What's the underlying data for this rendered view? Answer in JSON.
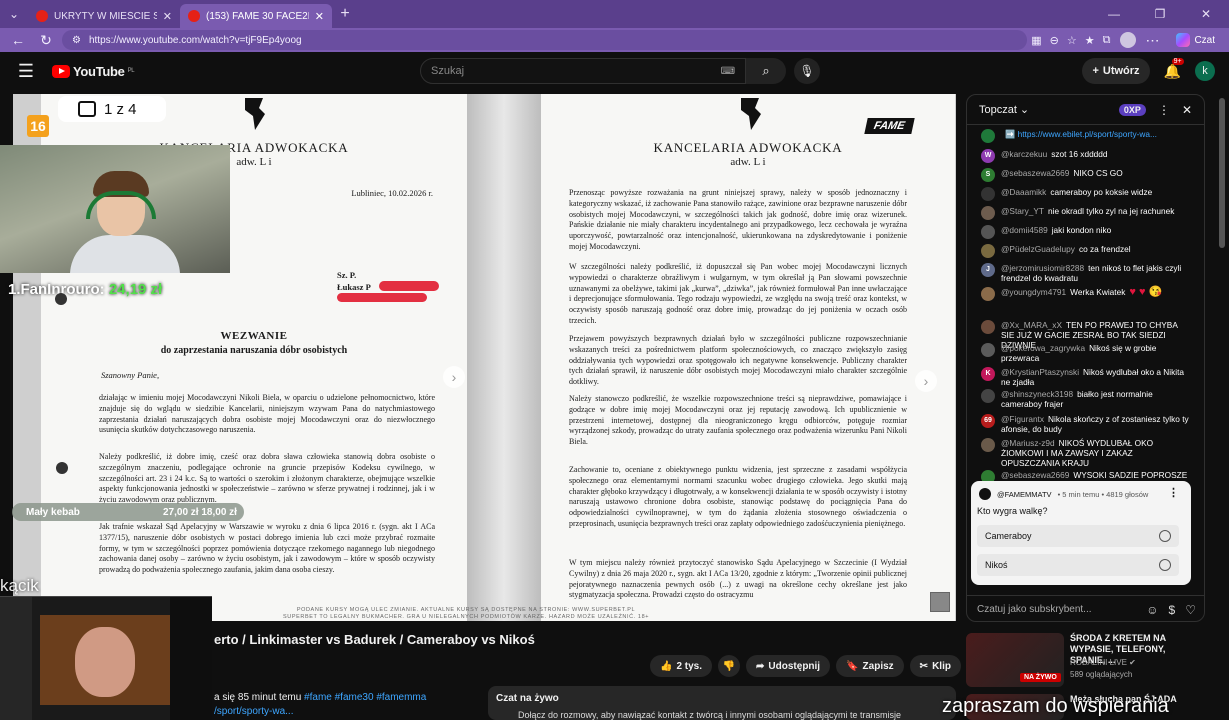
{
  "browser": {
    "tabs": [
      {
        "label": "UKRYTY W MIEŚCIE SZYB - YouTu"
      },
      {
        "label": "(153) FAME 30 FACE2FACE: Wiewió"
      }
    ],
    "url": "https://www.youtube.com/watch?v=tjF9Ep4yoog",
    "copilot_label": "Czat"
  },
  "youtube": {
    "logo": "YouTube",
    "logo_country": "PL",
    "search_placeholder": "Szukaj",
    "create_label": "Utwórz",
    "notif_count": "9+",
    "avatar_letter": "k"
  },
  "player": {
    "page_indicator": "1 z 4",
    "age_rating": "16",
    "fame_logo": "FAME",
    "left_doc": {
      "firm": "KANCELARIA ADWOKACKA",
      "firm_sub": "adw. L          i",
      "date": "Lubliniec, 10.02.2026 r.",
      "addr1": "Sz. P.",
      "addr2": "Łukasz P",
      "title": "WEZWANIE",
      "subtitle": "do zaprzestania naruszania dóbr osobistych",
      "salutation": "Szanowny Panie,",
      "p1": "działając w imieniu mojej Mocodawczyni Nikoli Biela, w oparciu o udzielone pełnomocnictwo, które znajduje się do wglądu w siedzibie Kancelarii, niniejszym wzywam Pana do natychmiastowego zaprzestania działań naruszających dobra osobiste mojej Mocodawczyni oraz do niezwłocznego usunięcia skutków dotychczasowego naruszenia.",
      "p2": "Należy podkreślić, iż dobre imię, cześć oraz dobra sława człowieka stanowią dobra osobiste o szczególnym znaczeniu, podlegające ochronie na gruncie przepisów Kodeksu cywilnego, w szczególności art. 23 i 24 k.c. Są to wartości o szerokim i złożonym charakterze, obejmujące wszelkie aspekty funkcjonowania jednostki w społeczeństwie – zarówno w sferze prywatnej i rodzinnej, jak i w życiu zawodowym oraz publicznym.",
      "p3": "Jak trafnie wskazał Sąd Apelacyjny w Warszawie w wyroku z dnia 6 lipca 2016 r. (sygn. akt I ACa 1377/15), naruszenie dóbr osobistych w postaci dobrego imienia lub czci może przybrać rozmaite formy, w tym w szczególności poprzez pomówienia dotyczące rzekomego nagannego lub niegodnego zachowania danej osoby – zarówno w życiu osobistym, jak i zawodowym – które w sposób oczywisty prowadzą do podważenia społecznego zaufania, jakim dana osoba cieszy."
    },
    "right_doc": {
      "firm": "KANCELARIA ADWOKACKA",
      "firm_sub": "adw. L          i",
      "p1": "Przenosząc powyższe rozważania na grunt niniejszej sprawy, należy w sposób jednoznaczny i kategoryczny wskazać, iż zachowanie Pana stanowiło rażące, zawinione oraz bezprawne naruszenie dóbr osobistych mojej Mocodawczyni, w szczególności takich jak godność, dobre imię oraz wizerunek. Pańskie działanie nie miały charakteru incydentalnego ani przypadkowego, lecz cechowała je wyraźna uporczywość, powtarzalność oraz intencjonalność, ukierunkowana na zdyskredytowanie i poniżenie mojej Mocodawczyni.",
      "p2": "W szczególności należy podkreślić, iż dopuszczał się Pan wobec mojej Mocodawczyni licznych wypowiedzi o charakterze obraźliwym i wulgarnym, w tym określał ją Pan słowami powszechnie uznawanymi za obelżywe, takimi jak „kurwa”, „dziwka”, jak również formułował Pan inne uwłaczające i deprecjonujące sformułowania. Tego rodzaju wypowiedzi, ze względu na swoją treść oraz kontekst, w oczywisty sposób naruszają godność oraz dobre imię, prowadząc do jej poniżenia w oczach osób trzecich.",
      "p3": "Przejawem powyższych bezprawnych działań było w szczególności publiczne rozpowszechnianie wskazanych treści za pośrednictwem platform społecznościowych, co znacząco zwiększyło zasięg oddziaływania tych wypowiedzi oraz spotęgowało ich negatywne konsekwencje. Publiczny charakter tych działań sprawił, iż naruszenie dóbr osobistych mojej Mocodawczyni miało charakter szczególnie dotkliwy.",
      "p4": "Należy stanowczo podkreślić, że wszelkie rozpowszechnione treści są nieprawdziwe, pomawiające i godzące w dobre imię mojej Mocodawczyni oraz jej reputację zawodową. Ich upublicznienie w przestrzeni internetowej, dostępnej dla nieograniczonego kręgu odbiorców, potęguje rozmiar wyrządzonej szkody, prowadząc do utraty zaufania społecznego oraz podważenia wizerunku Pani Nikoli Biela.",
      "p5": "Zachowanie to, oceniane z obiektywnego punktu widzenia, jest sprzeczne z zasadami współżycia społecznego oraz elementarnymi normami szacunku wobec drugiego człowieka. Jego skutki mają charakter głęboko krzywdzący i długotrwały, a w konsekwencji działania te w sposób oczywisty i istotny naruszają ustawowo chronione dobra osobiste, stanowiąc podstawę do pociągnięcia Pana do odpowiedzialności cywilnoprawnej, w tym do żądania złożenia stosownego oświadczenia o przeprosinach, usunięcia bezprawnych treści oraz zapłaty odpowiedniego zadośćuczynienia pieniężnego.",
      "p6": "W tym miejscu należy również przytoczyć stanowisko Sądu Apelacyjnego w Szczecinie (I Wydział Cywilny) z dnia 26 maja 2020 r., sygn. akt I ACa 13/20, zgodnie z którym: „Tworzenie opinii publicznej pejoratywnego naznaczenia pewnych osób (...) z uwagi na określone cechy określane jest jako stygmatyzacja społeczna. Prowadzi często do ostracyzmu"
    },
    "disclaimer": "PODANE KURSY MOGĄ ULEC ZMIANIE. AKTUALNE KURSY SĄ DOSTĘPNE NA STRONIE: WWW.SUPERBET.PL\nSUPERBET TO LEGALNY BUKMACHER. GRA U NIELEGALNYCH PODMIOTÓW KARZE. HAZARD MOŻE UZALEŻNIĆ. 18+",
    "fan_label": "1.FanInrouro:",
    "fan_amount": "24,19 zł",
    "kebab_label": "Mały kebab",
    "kebab_amount": "27,00 zł   18,00 zł",
    "kacik": "kącik"
  },
  "video": {
    "title": "erto / Linkimaster vs Badurek / Cameraboy vs Nikoś",
    "likes": "2 tys.",
    "share": "Udostępnij",
    "save": "Zapisz",
    "clip": "Klip",
    "desc_line1": "a się 85 minut temu",
    "desc_tags": "#fame #fame30 #famemma",
    "desc_line2": "/sport/sporty-wa...",
    "live_chat_title": "Czat na żywo",
    "live_chat_sub": "Dołącz do rozmowy, aby nawiązać kontakt z twórcą i innymi osobami oglądającymi te transmisje"
  },
  "chat": {
    "header": "Topczat",
    "points": "0XP",
    "messages": [
      {
        "author": "",
        "text": "",
        "link": "➡️ https://www.ebilet.pl/sport/sporty-wa...",
        "color": "#1f7a3a",
        "initial": ""
      },
      {
        "author": "@karczekuu",
        "text": "szot 16 xddddd",
        "color": "#8e3bb0",
        "initial": "W"
      },
      {
        "author": "@sebaszewa2669",
        "text": "NIKO CS GO",
        "color": "#2e7d32",
        "initial": "S"
      },
      {
        "author": "@Daaamikk",
        "text": "cameraboy po koksie widze",
        "color": "#333",
        "initial": ""
      },
      {
        "author": "@Stary_YT",
        "text": "nie okradl tylko zyl na jej rachunek",
        "color": "#6d5c4e",
        "initial": ""
      },
      {
        "author": "@domii4589",
        "text": "jaki kondon niko",
        "color": "#555",
        "initial": ""
      },
      {
        "author": "@PüdelzGuadelupy",
        "text": "co za frendzel",
        "color": "#7a6a40",
        "initial": ""
      },
      {
        "author": "@jerzomirusiomir8288",
        "text": "ten nikoś to flet jakis czyli frendzel do kwadratu",
        "color": "#5f6a8a",
        "initial": "J"
      },
      {
        "author": "@youngdym4791",
        "text": "Werka Kwiatek",
        "hearts": "♥ ♥ 😘",
        "color": "#8a6b4a",
        "initial": ""
      },
      {
        "author": "@Xx_MARA_xX",
        "text": "TEN PO PRAWEJ TO CHYBA SIE JUŻ W GACIE ZESRAŁ BO TAK SIEDZI DZIWNIE",
        "color": "#6b4b3b",
        "initial": ""
      },
      {
        "author": "@pokerowa_zagrywka",
        "text": "Nikoś się w grobie przewraca",
        "color": "#5b5b5b",
        "initial": ""
      },
      {
        "author": "@KrystianPtaszynski",
        "text": "Nikoś wydlubał oko a Nikita ne zjadła",
        "color": "#c2185b",
        "initial": "K"
      },
      {
        "author": "@shinszyneck3198",
        "text": "białko jest normalnie cameraboy frajer",
        "color": "#444",
        "initial": ""
      },
      {
        "author": "@Figurantx",
        "text": "Nikola skończy z of zostaniesz tylko ty afonsie, do budy",
        "color": "#b71c1c",
        "initial": "69"
      },
      {
        "author": "@Mariusz-z9d",
        "text": "NIKOŚ WYDLUBAŁ OKO ŻIOMKOWI I MA ZAWSAY I ZAKAZ OPUSZCZANIA KRAJU",
        "color": "#6a5a4a",
        "initial": ""
      },
      {
        "author": "@sebaszewa2669",
        "text": "WYSOKI SADZIE POPROSZE",
        "color": "#2e7d32",
        "initial": ""
      }
    ],
    "poll": {
      "channel": "@FAMEMMATV",
      "meta": "• 5 min temu • 4819 głosów",
      "question": "Kto wygra walkę?",
      "options": [
        "Cameraboy",
        "Nikoś"
      ]
    },
    "input_placeholder": "Czatuj jako subskrybent..."
  },
  "recs": [
    {
      "title": "ŚRODA Z KRETEM NA WYPASIE, TELEFONY, SPANIE, ...",
      "channel": "ROBALINI LIVE ✔",
      "views": "589 oglądających",
      "live": "NA ŻYWO"
    },
    {
      "title": "Mężą słucha pan ŚJ ADA",
      "channel": "",
      "views": "",
      "live": ""
    }
  ],
  "overlay_text": "zapraszam do wspierania"
}
